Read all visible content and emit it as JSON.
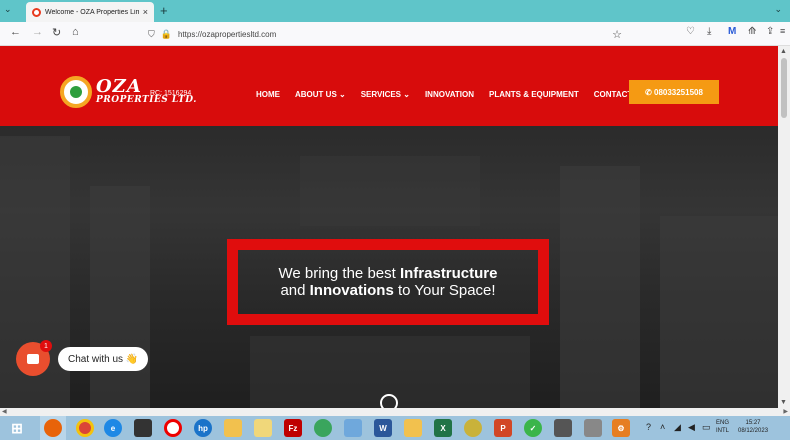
{
  "browser": {
    "tab_title": "Welcome - OZA Properties Lim",
    "tab_close": "×",
    "new_tab": "+",
    "list_all": "⌄",
    "tabs_dropdown": "⌄",
    "url": "https://ozapropertiesltd.com",
    "nav": {
      "back": "←",
      "forward": "→",
      "reload": "↻",
      "home": "⌂",
      "star": "☆",
      "shield": "⛉",
      "lock": "🔒"
    },
    "toolbar": {
      "pocket": "♡",
      "download": "⤓",
      "account": "M",
      "extensions": "⟰",
      "share": "⇪",
      "menu": "≡"
    }
  },
  "site": {
    "logo": {
      "name": "OZA",
      "sub": "PROPERTIES LTD.",
      "rc": "RC: 1516294"
    },
    "menu": [
      "HOME",
      "ABOUT US ⌄",
      "SERVICES ⌄",
      "INNOVATION",
      "PLANTS & EQUIPMENT",
      "CONTACT"
    ],
    "phone": "✆ 08033251508",
    "hero": {
      "line1_plain": "We bring the best ",
      "line1_bold": "Infrastructure",
      "line2_plain1": "and ",
      "line2_bold": "Innovations",
      "line2_plain2": " to Your Space!"
    },
    "chat": {
      "label": "Chat with us 👋",
      "badge": "1"
    }
  },
  "colors": {
    "header": "#d80c0c",
    "phone": "#f59a13",
    "hero_border": "#e00d0d",
    "tabstrip": "#5fc5c9"
  },
  "taskbar": {
    "icons": [
      "windows-start-icon",
      "firefox-icon",
      "chrome-icon",
      "edge-icon",
      "app-icon",
      "opera-icon",
      "hp-icon",
      "folder-icon",
      "mail-icon",
      "filezilla-icon",
      "app2-icon",
      "notes-icon",
      "word-icon",
      "files-icon",
      "excel-icon",
      "app3-icon",
      "powerpoint-icon",
      "check-icon",
      "app4-icon",
      "settings-icon"
    ],
    "lang": [
      "ENG",
      "INTL"
    ],
    "time": "15:27",
    "date": "08/12/2023"
  }
}
